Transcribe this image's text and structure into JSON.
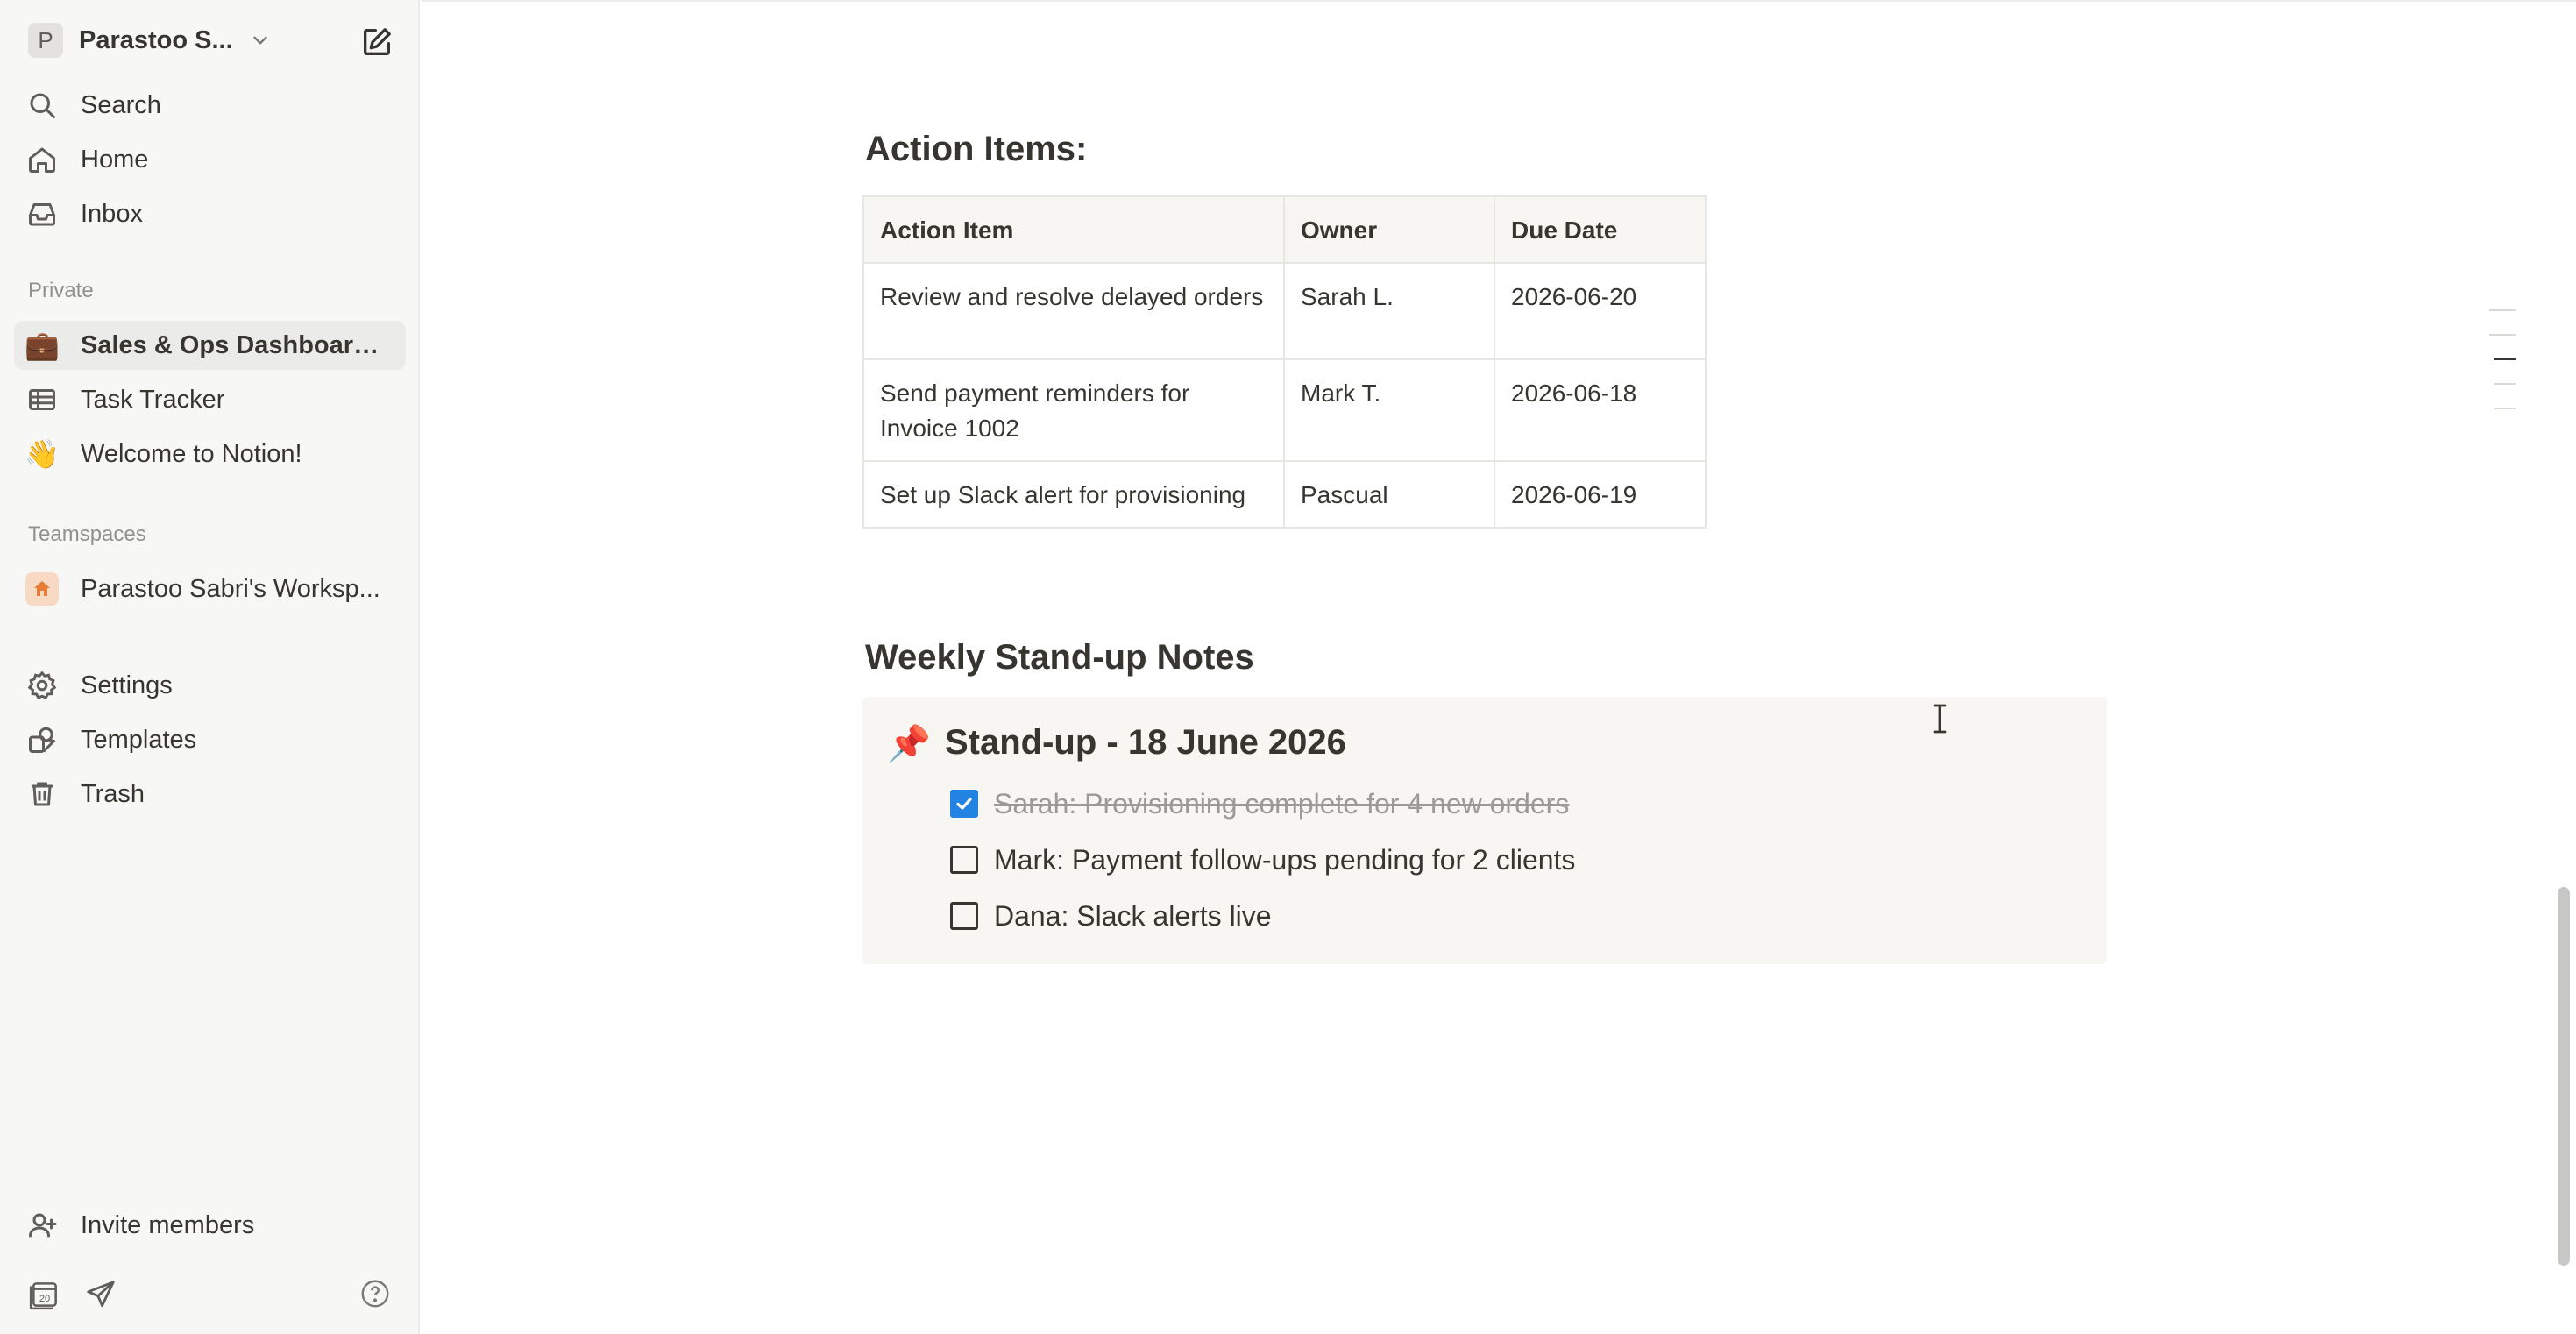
{
  "sidebar": {
    "workspace": {
      "avatar_letter": "P",
      "name": "Parastoo S..."
    },
    "top_nav": [
      {
        "label": "Search",
        "icon": "search-icon"
      },
      {
        "label": "Home",
        "icon": "home-icon"
      },
      {
        "label": "Inbox",
        "icon": "inbox-icon"
      }
    ],
    "private_label": "Private",
    "private_pages": [
      {
        "label": "Sales & Ops Dashboard ...",
        "icon": "💼",
        "active": true
      },
      {
        "label": "Task Tracker",
        "icon": "table-icon"
      },
      {
        "label": "Welcome to Notion!",
        "icon": "👋"
      }
    ],
    "teamspaces_label": "Teamspaces",
    "teamspace": {
      "label": "Parastoo Sabri's Worksp...",
      "icon": "home-icon"
    },
    "bottom_nav": [
      {
        "label": "Settings",
        "icon": "gear-icon"
      },
      {
        "label": "Templates",
        "icon": "templates-icon"
      },
      {
        "label": "Trash",
        "icon": "trash-icon"
      }
    ],
    "invite_label": "Invite members",
    "calendar_day": "20"
  },
  "page": {
    "action_items": {
      "heading": "Action Items:",
      "columns": [
        "Action Item",
        "Owner",
        "Due Date"
      ],
      "rows": [
        [
          "Review and resolve delayed orders",
          "Sarah L.",
          "2026-06-20"
        ],
        [
          "Send payment reminders for Invoice 1002",
          "Mark T.",
          "2026-06-18"
        ],
        [
          "Set up Slack alert for provisioning",
          "Pascual",
          "2026-06-19"
        ]
      ]
    },
    "standup": {
      "heading": "Weekly Stand-up Notes",
      "callout_icon": "📌",
      "callout_title": "Stand-up - 18 June 2026",
      "todos": [
        {
          "text": "Sarah: Provisioning complete for 4 new orders",
          "checked": true
        },
        {
          "text": "Mark: Payment follow-ups pending for 2 clients",
          "checked": false
        },
        {
          "text": "Dana: Slack alerts live",
          "checked": false
        }
      ]
    }
  },
  "colors": {
    "sidebar_bg": "#f7f7f5",
    "active_item_bg": "#ebebe9",
    "checkbox_checked": "#2383e2",
    "callout_bg": "#f7f6f3",
    "table_header_bg": "#f7f6f3"
  }
}
